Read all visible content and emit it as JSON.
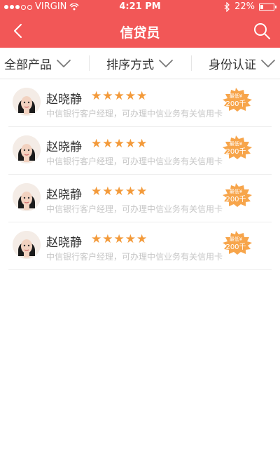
{
  "status": {
    "carrier": "VIRGIN",
    "time": "4:21 PM",
    "battery": "22%"
  },
  "header": {
    "title": "信贷员"
  },
  "filters": [
    {
      "label": "全部产品"
    },
    {
      "label": "排序方式"
    },
    {
      "label": "身份认证"
    }
  ],
  "items": [
    {
      "name": "赵晓静",
      "stars": "★★★★★",
      "desc": "中信银行客户经理，可办理中信业务有关信用卡",
      "badge_top": "最低¥",
      "badge_value": "200千"
    },
    {
      "name": "赵晓静",
      "stars": "★★★★★",
      "desc": "中信银行客户经理，可办理中信业务有关信用卡",
      "badge_top": "最低¥",
      "badge_value": "200千"
    },
    {
      "name": "赵晓静",
      "stars": "★★★★★",
      "desc": "中信银行客户经理，可办理中信业务有关信用卡",
      "badge_top": "最低¥",
      "badge_value": "200千"
    },
    {
      "name": "赵晓静",
      "stars": "★★★★★",
      "desc": "中信银行客户经理，可办理中信业务有关信用卡",
      "badge_top": "最低¥",
      "badge_value": "200千"
    }
  ],
  "colors": {
    "header": "#f25757",
    "star": "#f39a3a",
    "badge": "#f7a54b"
  }
}
